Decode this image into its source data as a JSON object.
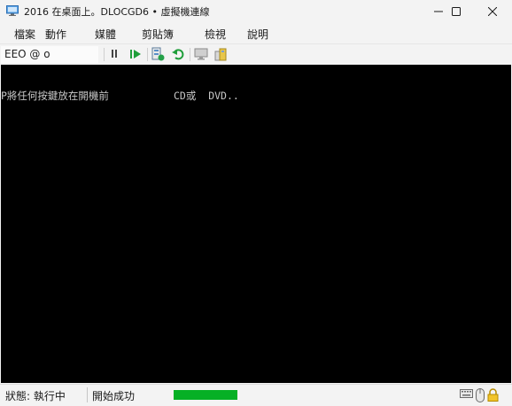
{
  "window": {
    "title": "2016 在桌面上。DLOCGD6 • 虛擬機連線",
    "icons": {
      "app": "vm-connect-icon",
      "minimize": "minimize-icon",
      "maximize": "maximize-icon",
      "close": "close-icon"
    }
  },
  "menu": {
    "items": [
      "檔案",
      "動作",
      "媒體",
      "剪貼簿",
      "檢視",
      "說明"
    ]
  },
  "toolbar": {
    "combo_value": "EEO @ o",
    "buttons": [
      "pause-icon",
      "resume-icon",
      "checkpoint-icon",
      "revert-icon",
      "enhanced-session-icon",
      "share-icon"
    ]
  },
  "screen": {
    "line_left": "P將任何按鍵放在開機前",
    "line_right": "CD或  DVD.."
  },
  "status": {
    "state": "狀態: 執行中",
    "message": "開始成功",
    "progress": 1.0,
    "icons": [
      "keyboard-icon",
      "mouse-icon",
      "lock-icon"
    ]
  },
  "colors": {
    "progress": "#06b025",
    "screen": "#000000"
  }
}
